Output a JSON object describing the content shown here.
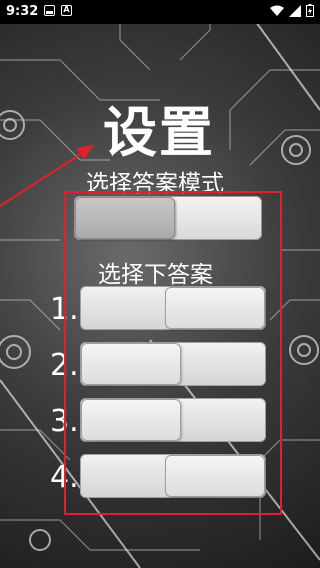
{
  "status_bar": {
    "time": "9:32"
  },
  "settings": {
    "title": "设置",
    "mode_label": "选择答案模式",
    "answers_label": "选择下答案",
    "rows": [
      {
        "number": "1.",
        "knob": "right"
      },
      {
        "number": "2.",
        "knob": "left"
      },
      {
        "number": "3.",
        "knob": "left"
      },
      {
        "number": "4.",
        "knob": "right"
      }
    ]
  },
  "colors": {
    "annotation": "#e0202a",
    "background": "#3c3c3c",
    "text": "#ffffff"
  }
}
